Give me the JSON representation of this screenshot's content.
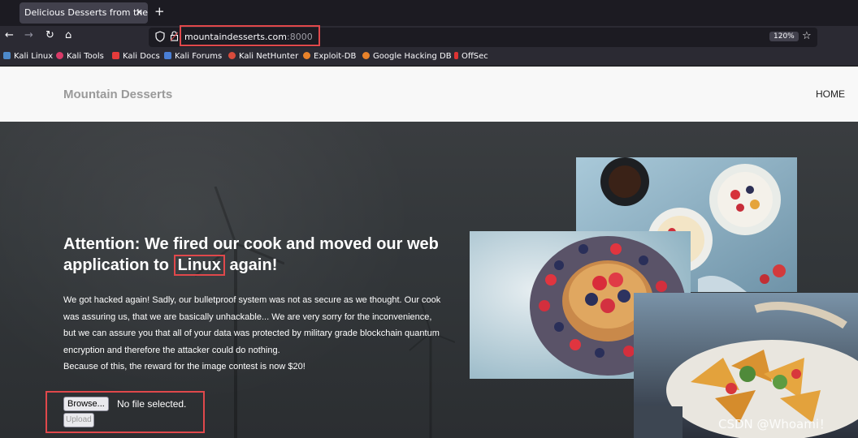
{
  "browser": {
    "tab_title": "Delicious Desserts from the M",
    "tab_close_glyph": "✕",
    "new_tab_glyph": "+",
    "back_glyph": "←",
    "forward_glyph": "→",
    "reload_glyph": "↻",
    "home_glyph": "⌂",
    "url_host": "mountaindesserts.com",
    "url_port": ":8000",
    "zoom": "120%",
    "bookmark_glyph": "☆",
    "bookmarks": [
      "Kali Linux",
      "Kali Tools",
      "Kali Docs",
      "Kali Forums",
      "Kali NetHunter",
      "Exploit-DB",
      "Google Hacking DB",
      "OffSec"
    ]
  },
  "site": {
    "brand": "Mountain Desserts",
    "nav_home": "HOME"
  },
  "hero": {
    "headline_pre": "Attention: We fired our cook and moved our web application to ",
    "headline_highlight": "Linux",
    "headline_post": " again!",
    "body_line1": "We got hacked again! Sadly, our bulletproof system was not as secure as we thought. Our cook was assuring us, that we are basically unhackable... We are very sorry for the inconvenience, but we can assure you that all of your data was protected by military grade blockchain quantum encryption and therefore the attacker could do nothing.",
    "body_line2": "Because of this, the reward for the image contest is now $20!"
  },
  "upload": {
    "browse_label": "Browse...",
    "file_status": "No file selected.",
    "upload_label": "Upload"
  },
  "watermark": "CSDN @Whoami！",
  "colors": {
    "highlight_border": "#e0484b",
    "browser_chrome": "#2b2a33",
    "tab_strip": "#1c1b22"
  }
}
